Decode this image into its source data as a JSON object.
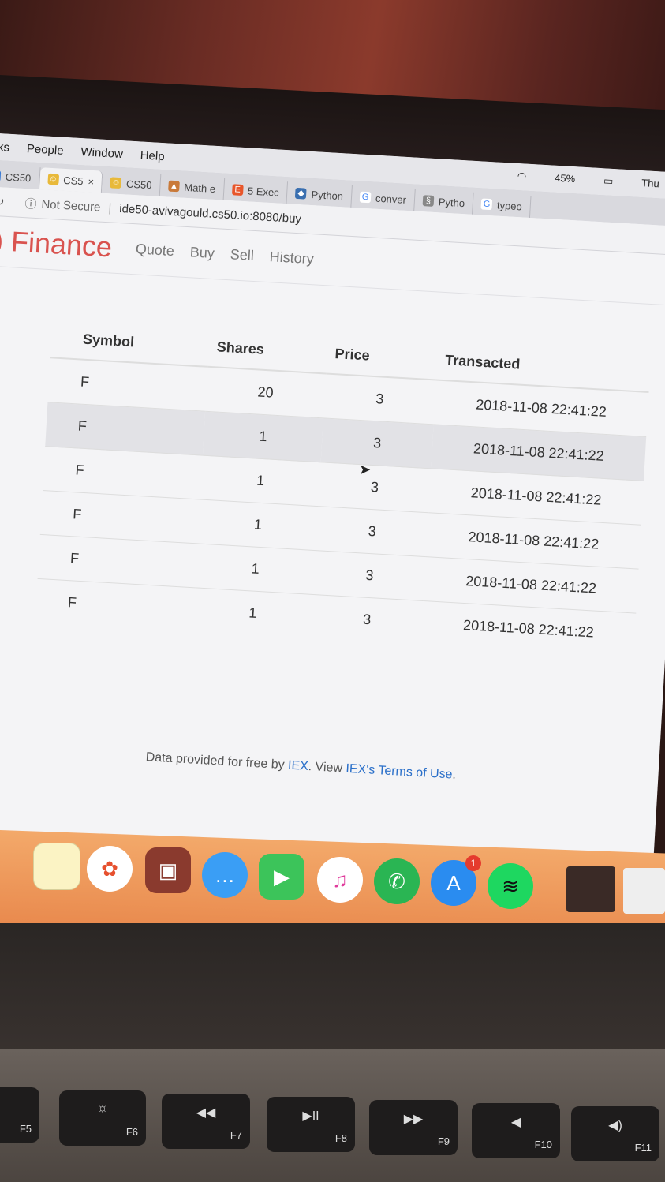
{
  "menubar": {
    "items": [
      "ks",
      "People",
      "Window",
      "Help"
    ],
    "battery": "45%",
    "clock": "Thu"
  },
  "tabs": [
    {
      "label": "CS50",
      "active": false
    },
    {
      "label": "CS5",
      "active": true,
      "close": "×"
    },
    {
      "label": "CS50",
      "active": false
    },
    {
      "label": "Math e",
      "active": false
    },
    {
      "label": "5 Exec",
      "active": false
    },
    {
      "label": "Python",
      "active": false
    },
    {
      "label": "conver",
      "active": false
    },
    {
      "label": "Pytho",
      "active": false
    },
    {
      "label": "typeo",
      "active": false
    }
  ],
  "address": {
    "security": "Not Secure",
    "url": "ide50-avivagould.cs50.io:8080/buy"
  },
  "nav": {
    "brand": "Finance",
    "links": [
      "Quote",
      "Buy",
      "Sell",
      "History"
    ]
  },
  "table": {
    "headers": [
      "Symbol",
      "Shares",
      "Price",
      "Transacted"
    ],
    "rows": [
      [
        "F",
        "20",
        "3",
        "2018-11-08 22:41:22"
      ],
      [
        "F",
        "1",
        "3",
        "2018-11-08 22:41:22"
      ],
      [
        "F",
        "1",
        "3",
        "2018-11-08 22:41:22"
      ],
      [
        "F",
        "1",
        "3",
        "2018-11-08 22:41:22"
      ],
      [
        "F",
        "1",
        "3",
        "2018-11-08 22:41:22"
      ],
      [
        "F",
        "1",
        "3",
        "2018-11-08 22:41:22"
      ]
    ]
  },
  "footer": {
    "prefix": "Data provided for free by ",
    "iex": "IEX",
    "middle": ". View ",
    "terms": "IEX's Terms of Use",
    "suffix": "."
  },
  "dock": {
    "apps": [
      "notes-icon",
      "photos-icon",
      "photo-booth-icon",
      "messages-icon",
      "facetime-icon",
      "itunes-icon",
      "whatsapp-icon",
      "app-store-icon",
      "spotify-icon"
    ],
    "app_store_badge": "1"
  },
  "keyboard": {
    "keys": [
      "F5",
      "F6",
      "F7",
      "F8",
      "F9",
      "F10",
      "F11"
    ]
  }
}
